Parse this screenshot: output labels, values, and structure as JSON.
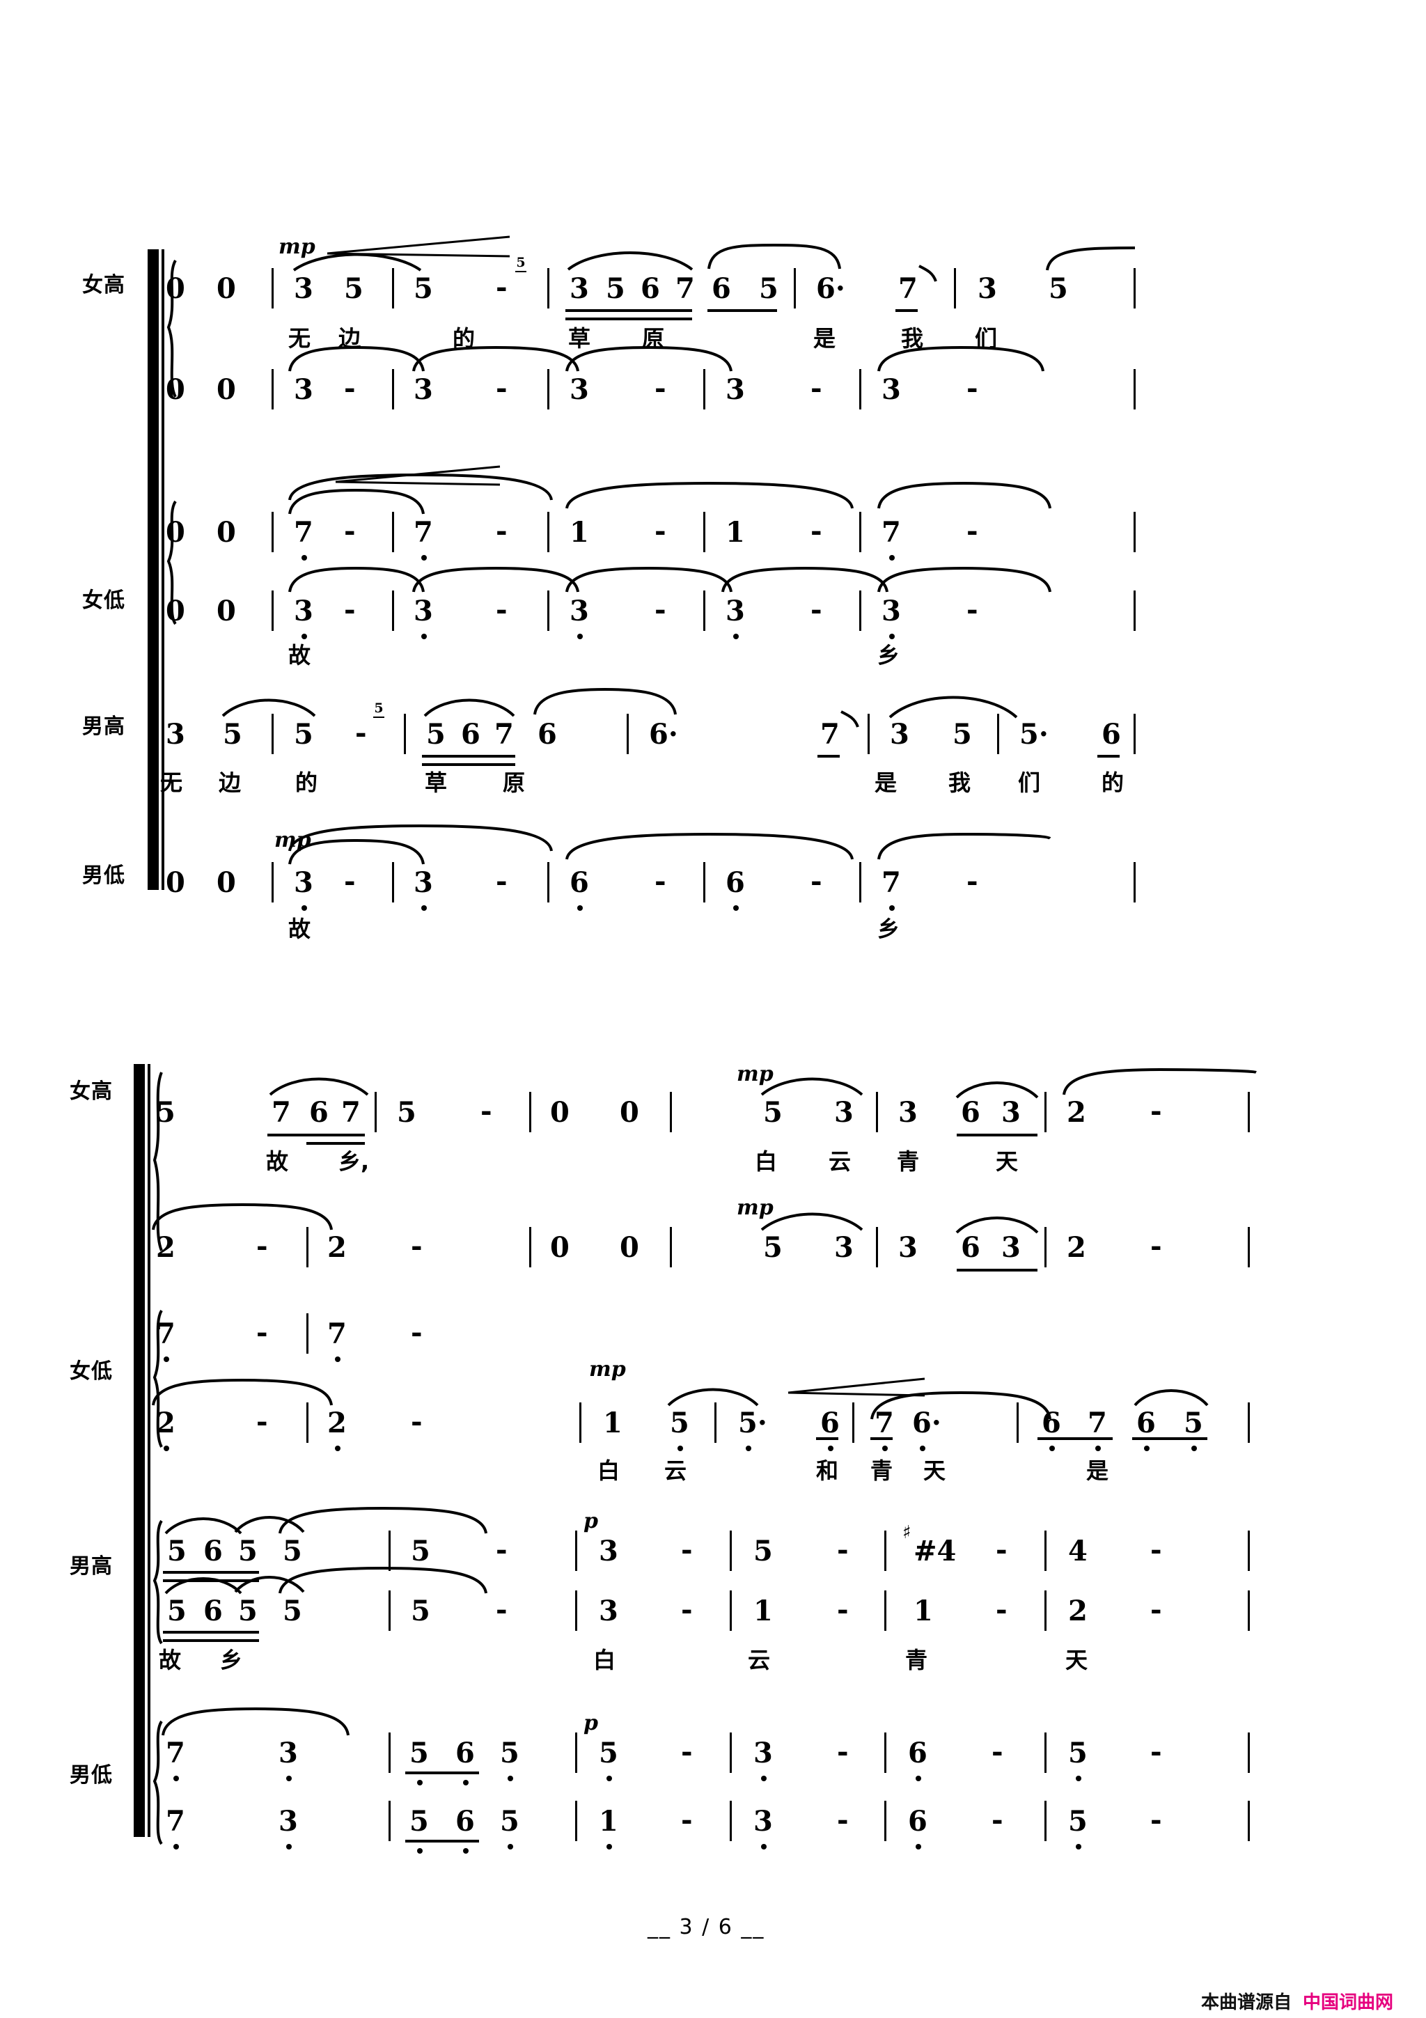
{
  "page": {
    "page_number": "3 / 6",
    "page_number_decorated": "__ 3 / 6 __",
    "watermark_prefix": "本曲谱源自",
    "watermark_site": "中国词曲网",
    "watermark_color": "#E6007E",
    "background": "#ffffff",
    "ink": "#000000",
    "notation_type": "jianpu-numbered-notation",
    "score_kind": "SATB choral score (4 parts, each divisi in 2 lines)"
  },
  "voice_labels": {
    "soprano": "女高",
    "alto": "女低",
    "tenor": "男高",
    "bass": "男低"
  },
  "dynamics": {
    "mp": "mp",
    "p": "p"
  },
  "systems": [
    {
      "id": "system-1",
      "parts": [
        {
          "id": "s1-soprano",
          "label": "女高",
          "dynamic": "mp",
          "hairpin": "crescendo",
          "staves": [
            {
              "id": "s1-soprano-upper",
              "measures": [
                {
                  "notes": [
                    "0",
                    "0"
                  ]
                },
                {
                  "notes": [
                    "3",
                    "5"
                  ]
                },
                {
                  "notes": [
                    "5",
                    "-"
                  ],
                  "superscript": "5"
                },
                {
                  "notes": [
                    "3",
                    "5",
                    "6",
                    "7",
                    "6",
                    "5"
                  ]
                },
                {
                  "notes": [
                    "6·",
                    "7"
                  ]
                },
                {
                  "notes": [
                    "3",
                    "5"
                  ]
                }
              ],
              "lyrics": [
                "无",
                "边",
                "的",
                "草",
                "原",
                "是",
                "我",
                "们"
              ]
            },
            {
              "id": "s1-soprano-lower",
              "measures": [
                {
                  "notes": [
                    "0",
                    "0"
                  ]
                },
                {
                  "notes": [
                    "3",
                    "-"
                  ]
                },
                {
                  "notes": [
                    "3",
                    "-"
                  ]
                },
                {
                  "notes": [
                    "3",
                    "-"
                  ]
                },
                {
                  "notes": [
                    "3",
                    "-"
                  ]
                },
                {
                  "notes": [
                    "3",
                    "-"
                  ]
                }
              ],
              "lyrics": []
            }
          ]
        },
        {
          "id": "s1-alto",
          "label": "女低",
          "dynamic": "",
          "hairpin": "crescendo",
          "staves": [
            {
              "id": "s1-alto-upper",
              "measures": [
                {
                  "notes": [
                    "0",
                    "0"
                  ]
                },
                {
                  "notes": [
                    "7",
                    "-"
                  ],
                  "octave": "low"
                },
                {
                  "notes": [
                    "7",
                    "-"
                  ],
                  "octave": "low"
                },
                {
                  "notes": [
                    "1",
                    "-"
                  ]
                },
                {
                  "notes": [
                    "1",
                    "-"
                  ]
                },
                {
                  "notes": [
                    "7",
                    "-"
                  ],
                  "octave": "low"
                }
              ],
              "lyrics": []
            },
            {
              "id": "s1-alto-lower",
              "measures": [
                {
                  "notes": [
                    "0",
                    "0"
                  ]
                },
                {
                  "notes": [
                    "3",
                    "-"
                  ],
                  "octave": "low"
                },
                {
                  "notes": [
                    "3",
                    "-"
                  ],
                  "octave": "low"
                },
                {
                  "notes": [
                    "3",
                    "-"
                  ],
                  "octave": "low"
                },
                {
                  "notes": [
                    "3",
                    "-"
                  ],
                  "octave": "low"
                },
                {
                  "notes": [
                    "3",
                    "-"
                  ],
                  "octave": "low"
                }
              ],
              "lyrics": [
                "故",
                "乡"
              ]
            }
          ]
        },
        {
          "id": "s1-tenor",
          "label": "男高",
          "dynamic": "",
          "staves": [
            {
              "id": "s1-tenor-single",
              "measures": [
                {
                  "notes": [
                    "3",
                    "5"
                  ]
                },
                {
                  "notes": [
                    "5",
                    "-"
                  ],
                  "superscript": "5"
                },
                {
                  "notes": [
                    "5",
                    "6",
                    "7",
                    "6"
                  ]
                },
                {
                  "notes": [
                    "6·",
                    "7"
                  ]
                },
                {
                  "notes": [
                    "3",
                    "5"
                  ]
                },
                {
                  "notes": [
                    "5·",
                    "6"
                  ]
                }
              ],
              "lyrics": [
                "无",
                "边",
                "的",
                "草",
                "原",
                "是",
                "我",
                "们",
                "的"
              ]
            }
          ]
        },
        {
          "id": "s1-bass",
          "label": "男低",
          "dynamic": "mp",
          "staves": [
            {
              "id": "s1-bass-single",
              "measures": [
                {
                  "notes": [
                    "0",
                    "0"
                  ]
                },
                {
                  "notes": [
                    "3",
                    "-"
                  ],
                  "octave": "low"
                },
                {
                  "notes": [
                    "3",
                    "-"
                  ],
                  "octave": "low"
                },
                {
                  "notes": [
                    "6",
                    "-"
                  ],
                  "octave": "low"
                },
                {
                  "notes": [
                    "6",
                    "-"
                  ],
                  "octave": "low"
                },
                {
                  "notes": [
                    "7",
                    "-"
                  ],
                  "octave": "low"
                }
              ],
              "lyrics": [
                "故",
                "乡"
              ]
            }
          ]
        }
      ]
    },
    {
      "id": "system-2",
      "parts": [
        {
          "id": "s2-soprano",
          "label": "女高",
          "dynamic": "mp",
          "staves": [
            {
              "id": "s2-soprano-upper",
              "measures": [
                {
                  "notes": [
                    "5",
                    "7",
                    "6",
                    "7"
                  ]
                },
                {
                  "notes": [
                    "5",
                    "-"
                  ]
                },
                {
                  "notes": [
                    "0",
                    "0"
                  ]
                },
                {
                  "notes": [
                    "5",
                    "3"
                  ]
                },
                {
                  "notes": [
                    "3",
                    "6",
                    "3"
                  ]
                },
                {
                  "notes": [
                    "2",
                    "-"
                  ]
                }
              ],
              "lyrics": [
                "故",
                "乡,",
                "白",
                "云",
                "青",
                "天"
              ]
            },
            {
              "id": "s2-soprano-lower",
              "measures": [
                {
                  "notes": [
                    "2",
                    "-"
                  ]
                },
                {
                  "notes": [
                    "2",
                    "-"
                  ]
                },
                {
                  "notes": [
                    "0",
                    "0"
                  ]
                },
                {
                  "notes": [
                    "5",
                    "3"
                  ]
                },
                {
                  "notes": [
                    "3",
                    "6",
                    "3"
                  ]
                },
                {
                  "notes": [
                    "2",
                    "-"
                  ]
                }
              ],
              "lyrics": []
            }
          ]
        },
        {
          "id": "s2-alto",
          "label": "女低",
          "dynamic": "mp",
          "hairpin": "crescendo",
          "staves": [
            {
              "id": "s2-alto-upper",
              "measures": [
                {
                  "notes": [
                    "7",
                    "-"
                  ],
                  "octave": "low"
                },
                {
                  "notes": [
                    "7",
                    "-"
                  ],
                  "octave": "low"
                }
              ],
              "lyrics": []
            },
            {
              "id": "s2-alto-lower",
              "measures": [
                {
                  "notes": [
                    "2",
                    "-"
                  ],
                  "octave": "low"
                },
                {
                  "notes": [
                    "2",
                    "-"
                  ],
                  "octave": "low"
                },
                {
                  "notes": [
                    "1",
                    "5"
                  ]
                },
                {
                  "notes": [
                    "5·",
                    "6"
                  ]
                },
                {
                  "notes": [
                    "7",
                    "6·"
                  ]
                },
                {
                  "notes": [
                    "6",
                    "7",
                    "6",
                    "5"
                  ]
                }
              ],
              "lyrics": [
                "白",
                "云",
                "和",
                "青",
                "天",
                "是"
              ]
            }
          ]
        },
        {
          "id": "s2-tenor",
          "label": "男高",
          "dynamic": "p",
          "staves": [
            {
              "id": "s2-tenor-upper",
              "measures": [
                {
                  "notes": [
                    "5",
                    "6",
                    "5",
                    "5"
                  ]
                },
                {
                  "notes": [
                    "5",
                    "-"
                  ]
                },
                {
                  "notes": [
                    "3",
                    "-"
                  ]
                },
                {
                  "notes": [
                    "5",
                    "-"
                  ]
                },
                {
                  "notes": [
                    "#4",
                    "-"
                  ],
                  "accidental": "#"
                },
                {
                  "notes": [
                    "4",
                    "-"
                  ]
                }
              ],
              "lyrics": []
            },
            {
              "id": "s2-tenor-lower",
              "measures": [
                {
                  "notes": [
                    "5",
                    "6",
                    "5",
                    "5"
                  ]
                },
                {
                  "notes": [
                    "5",
                    "-"
                  ]
                },
                {
                  "notes": [
                    "3",
                    "-"
                  ]
                },
                {
                  "notes": [
                    "1",
                    "-"
                  ]
                },
                {
                  "notes": [
                    "1",
                    "-"
                  ]
                },
                {
                  "notes": [
                    "2",
                    "-"
                  ]
                }
              ],
              "lyrics": [
                "故",
                "乡",
                "白",
                "云",
                "青",
                "天"
              ]
            }
          ]
        },
        {
          "id": "s2-bass",
          "label": "男低",
          "dynamic": "p",
          "staves": [
            {
              "id": "s2-bass-upper",
              "measures": [
                {
                  "notes": [
                    "7",
                    "3"
                  ],
                  "octave": "low"
                },
                {
                  "notes": [
                    "5",
                    "6",
                    "5"
                  ],
                  "octave": "low"
                },
                {
                  "notes": [
                    "5",
                    "-"
                  ],
                  "octave": "low"
                },
                {
                  "notes": [
                    "3",
                    "-"
                  ],
                  "octave": "low"
                },
                {
                  "notes": [
                    "6",
                    "-"
                  ],
                  "octave": "low"
                },
                {
                  "notes": [
                    "5",
                    "-"
                  ],
                  "octave": "low"
                }
              ],
              "lyrics": []
            },
            {
              "id": "s2-bass-lower",
              "measures": [
                {
                  "notes": [
                    "7",
                    "3"
                  ],
                  "octave": "low"
                },
                {
                  "notes": [
                    "5",
                    "6",
                    "5"
                  ],
                  "octave": "low"
                },
                {
                  "notes": [
                    "1",
                    "-"
                  ],
                  "octave": "low"
                },
                {
                  "notes": [
                    "3",
                    "-"
                  ],
                  "octave": "low"
                },
                {
                  "notes": [
                    "6",
                    "-"
                  ],
                  "octave": "low"
                },
                {
                  "notes": [
                    "5",
                    "-"
                  ],
                  "octave": "low"
                }
              ],
              "lyrics": []
            }
          ]
        }
      ]
    }
  ],
  "lyrics_full": {
    "system1_line1": "无 边 的 草 原 是 我 们",
    "system1_alto": "故 乡",
    "system1_tenor": "无 边 的 草 原 是 我 们 的",
    "system1_bass": "故 乡",
    "system2_soprano": "故 乡, 白 云 青 天",
    "system2_alto": "白 云 和 青 天 是",
    "system2_tenor": "故 乡 白 云 青 天"
  }
}
